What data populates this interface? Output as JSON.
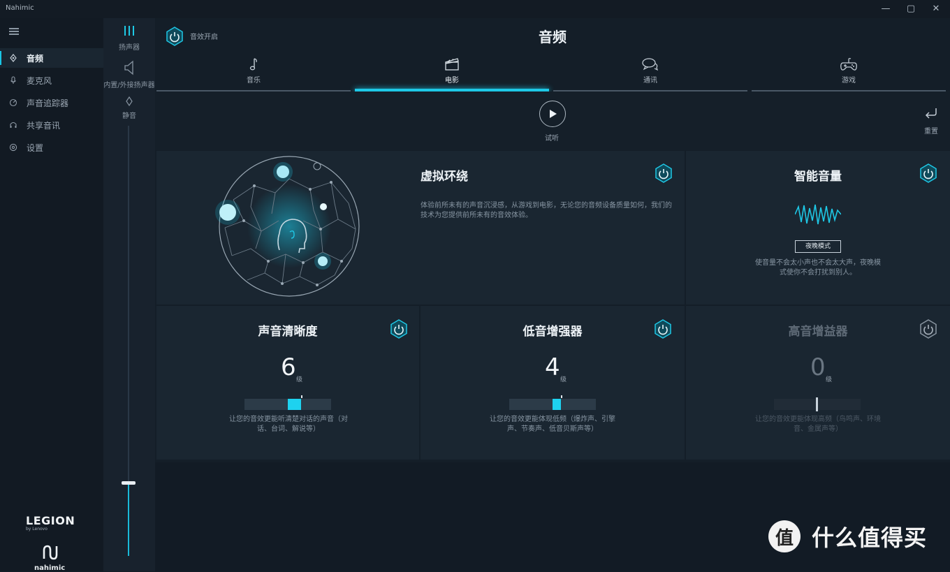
{
  "window": {
    "app_title": "Nahimic",
    "minimize": "—",
    "maximize": "▢",
    "close": "✕"
  },
  "sidebar": {
    "items": [
      {
        "label": "音频",
        "icon": "audio-icon"
      },
      {
        "label": "麦克风",
        "icon": "microphone-icon"
      },
      {
        "label": "声音追踪器",
        "icon": "sound-tracker-icon"
      },
      {
        "label": "共享音讯",
        "icon": "sound-sharing-icon"
      },
      {
        "label": "设置",
        "icon": "settings-icon"
      }
    ],
    "brand": {
      "legion": "LEGION",
      "legion_sub": "by Lenovo",
      "nahimic": "nahimic"
    }
  },
  "outputs": {
    "items": [
      {
        "label": "扬声器",
        "icon": "speaker-bars-icon"
      },
      {
        "label": "内置/外接扬声器",
        "icon": "speaker-icon"
      },
      {
        "label": "静音",
        "icon": "mute-icon"
      }
    ],
    "volume_level": 0.17
  },
  "header": {
    "master_label": "音效开启",
    "title": "音频"
  },
  "tabs": [
    {
      "label": "音乐",
      "icon": "music-note-icon"
    },
    {
      "label": "电影",
      "icon": "clapperboard-icon"
    },
    {
      "label": "通讯",
      "icon": "chat-icon"
    },
    {
      "label": "游戏",
      "icon": "gamepad-icon"
    }
  ],
  "preview": {
    "play_label": "试听",
    "reset_label": "重置"
  },
  "panels": {
    "virtual_surround": {
      "title": "虚拟环绕",
      "desc": "体验前所未有的声音沉浸感，从游戏到电影，无论您的音频设备质量如何，我们的技术为您提供前所未有的音效体验。",
      "enabled": true
    },
    "smart_volume": {
      "title": "智能音量",
      "mode": "夜晚模式",
      "desc": "使音量不会太小声也不会太大声，夜晚模式使你不会打扰到别人。",
      "enabled": true
    },
    "voice_clarity": {
      "title": "声音清晰度",
      "value": "6",
      "unit": "级",
      "level": 0.6,
      "desc": "让您的音效更能听清楚对话的声音（对话、台词、解说等）",
      "enabled": true
    },
    "bass_boost": {
      "title": "低音增强器",
      "value": "4",
      "unit": "级",
      "level": 0.4,
      "desc": "让您的音效更能体现低频（爆炸声、引擎声、节奏声、低音贝斯声等）",
      "enabled": true
    },
    "treble_boost": {
      "title": "高音增益器",
      "value": "0",
      "unit": "级",
      "level": 0.0,
      "desc": "让您的音效更能体现高频（鸟鸣声、环境音、金属声等）",
      "enabled": false
    }
  },
  "watermark": {
    "badge": "值",
    "text": "什么值得买"
  },
  "colors": {
    "accent": "#1ec8e6",
    "panel": "#1a2631",
    "background": "#141e28"
  }
}
